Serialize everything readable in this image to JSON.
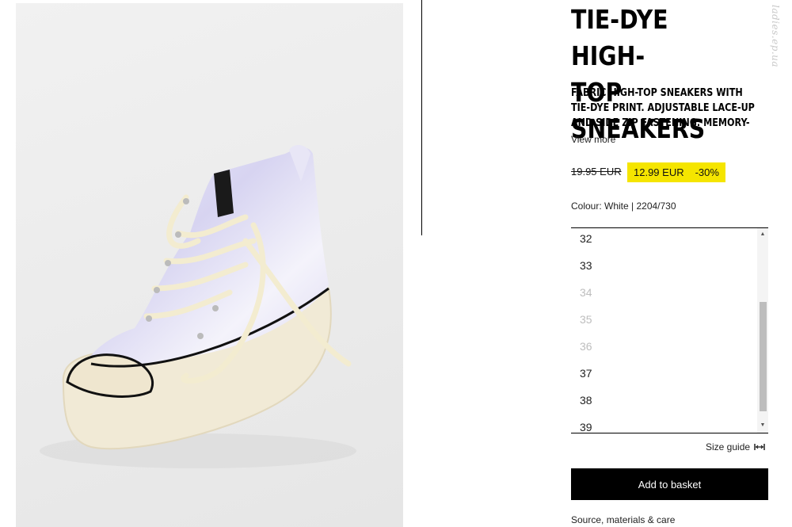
{
  "product": {
    "title": "TIE-DYE HIGH-\nTOP SNEAKERS",
    "description": "FABRIC HIGH-TOP SNEAKERS WITH TIE-DYE PRINT. ADJUSTABLE LACE-UP AND SIDE ZIP FASTENING. MEMORY-EFFECT",
    "view_more": "View more",
    "old_price": "19.95 EUR",
    "new_price": "12.99 EUR",
    "discount": "-30%",
    "colour_text": "Colour: White | 2204/730"
  },
  "sizes": [
    {
      "label": "32",
      "available": true
    },
    {
      "label": "33",
      "available": true
    },
    {
      "label": "34",
      "available": false
    },
    {
      "label": "35",
      "available": false
    },
    {
      "label": "36",
      "available": false
    },
    {
      "label": "37",
      "available": true
    },
    {
      "label": "38",
      "available": true
    },
    {
      "label": "39",
      "available": true
    }
  ],
  "size_guide": "Size guide",
  "add_to_basket": "Add to basket",
  "source_materials": "Source, materials & care",
  "watermark": "ladies.ep.ua",
  "colors": {
    "price_highlight": "#f5e500",
    "button_bg": "#000000",
    "unavailable_size": "#bdbdbd"
  }
}
